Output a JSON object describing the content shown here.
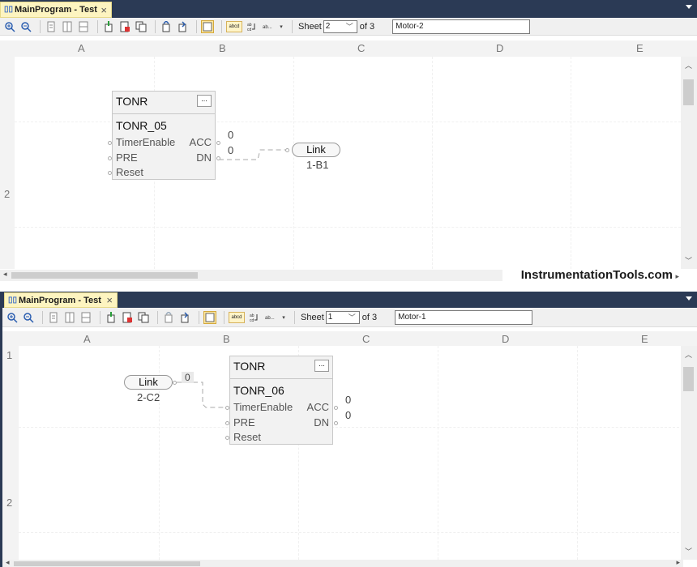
{
  "colors": {
    "tabbar": "#2b3a55",
    "tab": "#fdf4c0",
    "block": "#f2f2f2"
  },
  "watermark": "InstrumentationTools.com",
  "panes": [
    {
      "tab_title": "MainProgram - Test",
      "tab_close": "×",
      "sheet_label": "Sheet",
      "sheet_value": "2",
      "of_label": "of 3",
      "sheet_name": "Motor-2",
      "columns": [
        "A",
        "B",
        "C",
        "D",
        "E"
      ],
      "rows": [
        "2"
      ],
      "block": {
        "type": "TONR",
        "dots": "...",
        "name": "TONR_05",
        "inputs": [
          "TimerEnable",
          "PRE",
          "Reset"
        ],
        "outputs": [
          "ACC",
          "DN"
        ]
      },
      "values": [
        "0",
        "0"
      ],
      "link": {
        "label": "Link",
        "ref": "1-B1"
      }
    },
    {
      "tab_title": "MainProgram - Test",
      "tab_close": "×",
      "sheet_label": "Sheet",
      "sheet_value": "1",
      "of_label": "of 3",
      "sheet_name": "Motor-1",
      "columns": [
        "A",
        "B",
        "C",
        "D",
        "E"
      ],
      "rows": [
        "1",
        "2"
      ],
      "block": {
        "type": "TONR",
        "dots": "...",
        "name": "TONR_06",
        "inputs": [
          "TimerEnable",
          "PRE",
          "Reset"
        ],
        "outputs": [
          "ACC",
          "DN"
        ]
      },
      "link_value": "0",
      "values": [
        "0",
        "0"
      ],
      "link": {
        "label": "Link",
        "ref": "2-C2"
      }
    }
  ]
}
